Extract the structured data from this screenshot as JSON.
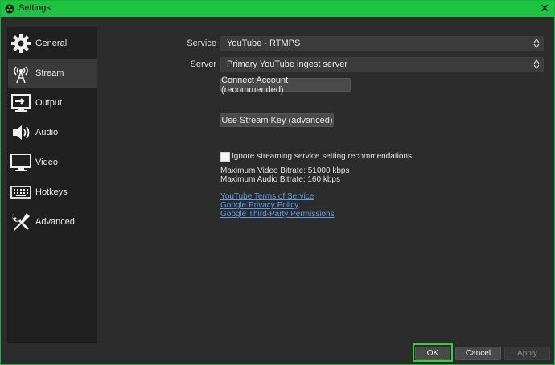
{
  "window": {
    "title": "Settings",
    "close_glyph": "✕"
  },
  "sidebar": {
    "items": [
      {
        "label": "General",
        "icon": "gear-icon"
      },
      {
        "label": "Stream",
        "icon": "antenna-icon",
        "selected": true
      },
      {
        "label": "Output",
        "icon": "output-icon"
      },
      {
        "label": "Audio",
        "icon": "speaker-icon"
      },
      {
        "label": "Video",
        "icon": "monitor-icon"
      },
      {
        "label": "Hotkeys",
        "icon": "keyboard-icon"
      },
      {
        "label": "Advanced",
        "icon": "wrench-screwdriver-icon"
      }
    ]
  },
  "stream": {
    "service_label": "Service",
    "service_value": "YouTube - RTMPS",
    "server_label": "Server",
    "server_value": "Primary YouTube ingest server",
    "connect_account_label": "Connect Account (recommended)",
    "stream_key_label": "Use Stream Key (advanced)",
    "ignore_recommendations_label": "Ignore streaming service setting recommendations",
    "ignore_recommendations_checked": false,
    "max_video_bitrate": "Maximum Video Bitrate: 51000 kbps",
    "max_audio_bitrate": "Maximum Audio Bitrate: 160 kbps",
    "links": [
      "YouTube Terms of Service",
      "Google Privacy Policy",
      "Google Third-Party Permissions"
    ]
  },
  "footer": {
    "ok_label": "OK",
    "cancel_label": "Cancel",
    "apply_label": "Apply"
  },
  "colors": {
    "titlebar": "#1ec441",
    "highlight": "#28d832",
    "link": "#5b9fea"
  }
}
